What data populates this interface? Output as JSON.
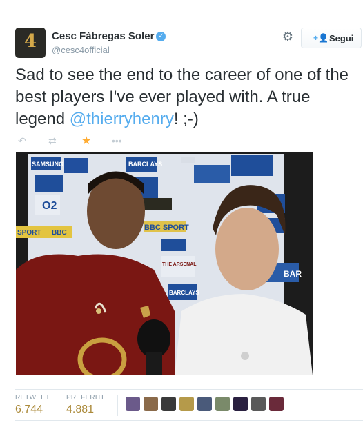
{
  "header": {
    "display_name": "Cesc Fàbregas Soler",
    "handle": "@cesc4official",
    "verified_icon": "verified-icon",
    "avatar_text": "4",
    "follow_label": "Segui",
    "gear_icon": "gear-icon"
  },
  "tweet": {
    "text_before": "Sad to see the end to the career of one of the best players I've ever played with. A true legend ",
    "mention": "@thierryhenry",
    "text_after": "! ;-)"
  },
  "actions": {
    "reply_icon": "reply-icon",
    "retweet_icon": "retweet-icon",
    "favorite_icon": "star-icon",
    "more_icon": "more-icon"
  },
  "media": {
    "board_texts": [
      "SAMSUNG",
      "BARCLAYS",
      "O2",
      "BBC SPORT",
      "SPORT",
      "BBC",
      "THE ARSENAL",
      "BARCLAYS",
      "BAR"
    ]
  },
  "stats": {
    "retweet_label": "RETWEET",
    "retweet_count": "6.744",
    "favorites_label": "PREFERITI",
    "favorites_count": "4.881"
  },
  "colors": {
    "link": "#55acee",
    "stat_value": "#ab8a3a",
    "favorite_star": "#ffac33"
  }
}
